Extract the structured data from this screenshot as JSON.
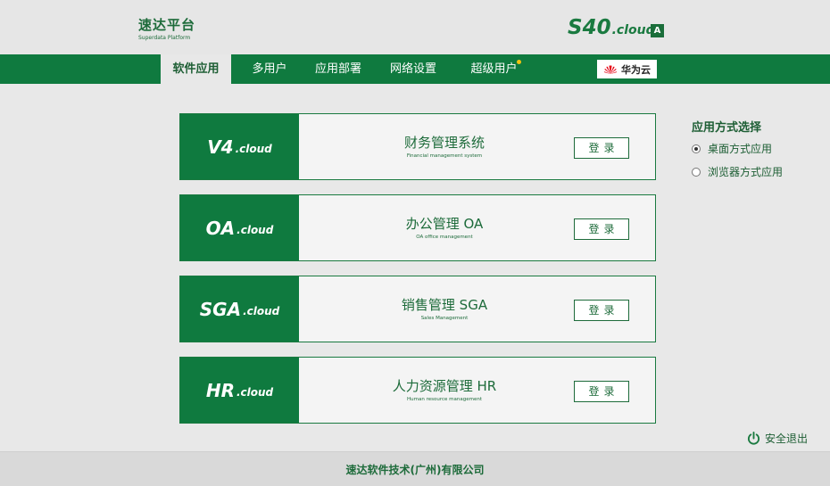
{
  "header": {
    "brand_title": "速达平台",
    "brand_sub": "Superdata Platform",
    "product_main": "S40",
    "product_suffix": ".cloud",
    "font_badge": "A"
  },
  "nav": {
    "items": [
      {
        "label": "软件应用",
        "active": true
      },
      {
        "label": "多用户",
        "active": false
      },
      {
        "label": "应用部署",
        "active": false
      },
      {
        "label": "网络设置",
        "active": false
      },
      {
        "label": "超级用户",
        "active": false,
        "notification_dot": true
      }
    ],
    "partner_label": "华为云",
    "partner_icon": "huawei-logo-icon"
  },
  "apps": [
    {
      "logo_main": "V4",
      "logo_suffix": ".cloud",
      "title": "财务管理系统",
      "subtitle": "Financial management system",
      "button": "登录"
    },
    {
      "logo_main": "OA",
      "logo_suffix": ".cloud",
      "title": "办公管理 OA",
      "subtitle": "OA office management",
      "button": "登录"
    },
    {
      "logo_main": "SGA",
      "logo_suffix": ".cloud",
      "title": "销售管理 SGA",
      "subtitle": "Sales Management",
      "button": "登录"
    },
    {
      "logo_main": "HR",
      "logo_suffix": ".cloud",
      "title": "人力资源管理 HR",
      "subtitle": "Human resource management",
      "button": "登录"
    }
  ],
  "side_panel": {
    "title": "应用方式选择",
    "options": [
      {
        "label": "桌面方式应用",
        "checked": true
      },
      {
        "label": "浏览器方式应用",
        "checked": false
      }
    ]
  },
  "logout": {
    "label": "安全退出",
    "icon": "power-icon"
  },
  "footer": {
    "company": "速达软件技术(广州)有限公司"
  },
  "colors": {
    "primary": "#0f7a3f",
    "text_green": "#1d6b3a",
    "background": "#e8e8e8",
    "notification": "#f2c20f"
  }
}
